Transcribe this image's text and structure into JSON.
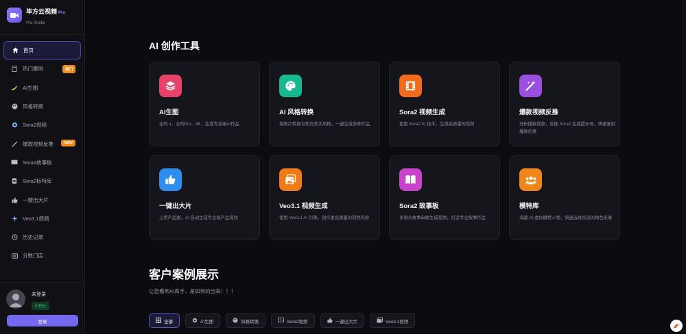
{
  "brand": {
    "name": "毕方云视频",
    "pro": "Pro",
    "sub": "Pro Studio"
  },
  "nav": [
    {
      "label": "首页",
      "icon": "home-icon",
      "active": true
    },
    {
      "label": "热门案例",
      "icon": "book-icon",
      "badge": "热门",
      "badge_color": "#f08c1c"
    },
    {
      "label": "AI生图",
      "icon": "banana-icon"
    },
    {
      "label": "风格转换",
      "icon": "palette-icon"
    },
    {
      "label": "Sora2视频",
      "icon": "gear-icon"
    },
    {
      "label": "爆款视频反推",
      "icon": "magic-wand-icon",
      "badge": "NEW",
      "badge_color": "#f08c1c"
    },
    {
      "label": "Sora2故事板",
      "icon": "open-book-icon"
    },
    {
      "label": "Sora2标特库",
      "icon": "document-icon"
    },
    {
      "label": "一键出大片",
      "icon": "thumbs-up-icon"
    },
    {
      "label": "Veo3.1视频",
      "icon": "sparkle-icon"
    },
    {
      "label": "历史记录",
      "icon": "history-icon"
    },
    {
      "label": "分数门店",
      "icon": "list-icon"
    }
  ],
  "user": {
    "name": "未登录",
    "credits": "0 积分",
    "login": "登录"
  },
  "tools": {
    "title": "AI 创作工具",
    "cards": [
      {
        "title": "AI生图",
        "desc": "全的.1、全的Pro、4K，生成专业级AI作品",
        "icon": "layers-icon",
        "color": "#e8426b"
      },
      {
        "title": "AI 风格转换",
        "desc": "将照片转换为任何艺术风格，一键生成多种作品",
        "icon": "palette-icon",
        "color": "#17b890"
      },
      {
        "title": "Sora2 视频生成",
        "desc": "使用 Sora2 AI 技术，生成高质量的视频",
        "icon": "film-icon",
        "color": "#f26a1b"
      },
      {
        "title": "爆款视频反推",
        "desc": "分析爆款视频，反推 Sora2 生成提示词，快速复刻爆款创意",
        "icon": "magic-wand-icon",
        "color": "#9b4fe0"
      },
      {
        "title": "一键出大片",
        "desc": "上传产品图，AI 自动生成专业级产品视频",
        "icon": "thumbs-up-icon",
        "color": "#2d8ef0"
      },
      {
        "title": "Veo3.1 视频生成",
        "desc": "使用 Veo3.1 AI 引擎，创作更高质量的视频内容",
        "icon": "images-icon",
        "color": "#f07a14"
      },
      {
        "title": "Sora2 故事板",
        "desc": "多镜头故事串联生成视频，打造专业叙事作品",
        "icon": "open-book-icon",
        "color": "#c744c9"
      },
      {
        "title": "模特库",
        "desc": "海量 AI 虚拟模特人物，快速选择合适的角色形象",
        "icon": "users-icon",
        "color": "#f0851a"
      }
    ]
  },
  "showcase": {
    "title": "客户案例展示",
    "subtitle": "让您看到AI高手，是如何的出来！！！",
    "filters": [
      {
        "label": "全部",
        "icon": "grid-icon",
        "active": true
      },
      {
        "label": "AI生图",
        "icon": "gear-icon"
      },
      {
        "label": "风格转换",
        "icon": "palette-icon"
      },
      {
        "label": "Sora2视频",
        "icon": "video-icon"
      },
      {
        "label": "一键出大片",
        "icon": "thumbs-up-icon"
      },
      {
        "label": "Veo3.1视频",
        "icon": "images-icon"
      }
    ]
  }
}
